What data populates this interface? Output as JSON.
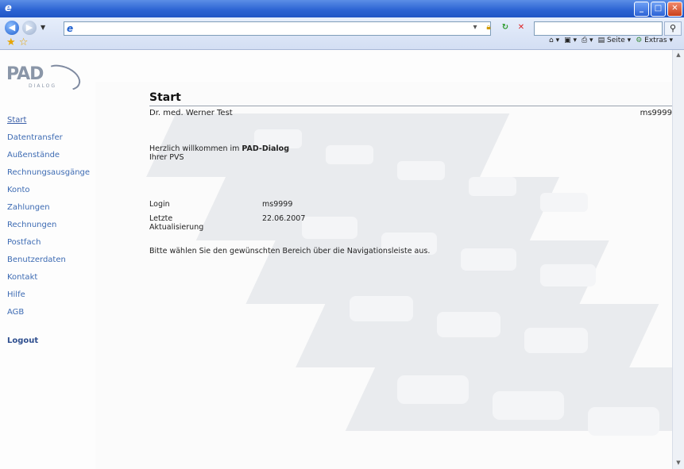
{
  "browser": {
    "address_value": "",
    "search_value": "",
    "cmd_seite": "Seite",
    "cmd_extras": "Extras"
  },
  "logo": {
    "brand": "PAD",
    "sub": "DIALOG"
  },
  "nav": {
    "items": [
      {
        "label": "Start"
      },
      {
        "label": "Datentransfer"
      },
      {
        "label": "Außenstände"
      },
      {
        "label": "Rechnungsausgänge"
      },
      {
        "label": "Konto"
      },
      {
        "label": "Zahlungen"
      },
      {
        "label": "Rechnungen"
      },
      {
        "label": "Postfach"
      },
      {
        "label": "Benutzerdaten"
      },
      {
        "label": "Kontakt"
      },
      {
        "label": "Hilfe"
      },
      {
        "label": "AGB"
      }
    ],
    "logout": "Logout"
  },
  "page": {
    "title": "Start",
    "doctor": "Dr. med. Werner Test",
    "user_id": "ms9999",
    "welcome_prefix": "Herzlich willkommen im ",
    "welcome_brand": "PAD-Dialog",
    "welcome_line2": "Ihrer PVS",
    "info": [
      {
        "key": "Login",
        "value": "ms9999"
      },
      {
        "key": "Letzte Aktualisierung",
        "value": "22.06.2007"
      }
    ],
    "hint": "Bitte wählen Sie den gewünschten Bereich über die Navigationsleiste aus."
  }
}
